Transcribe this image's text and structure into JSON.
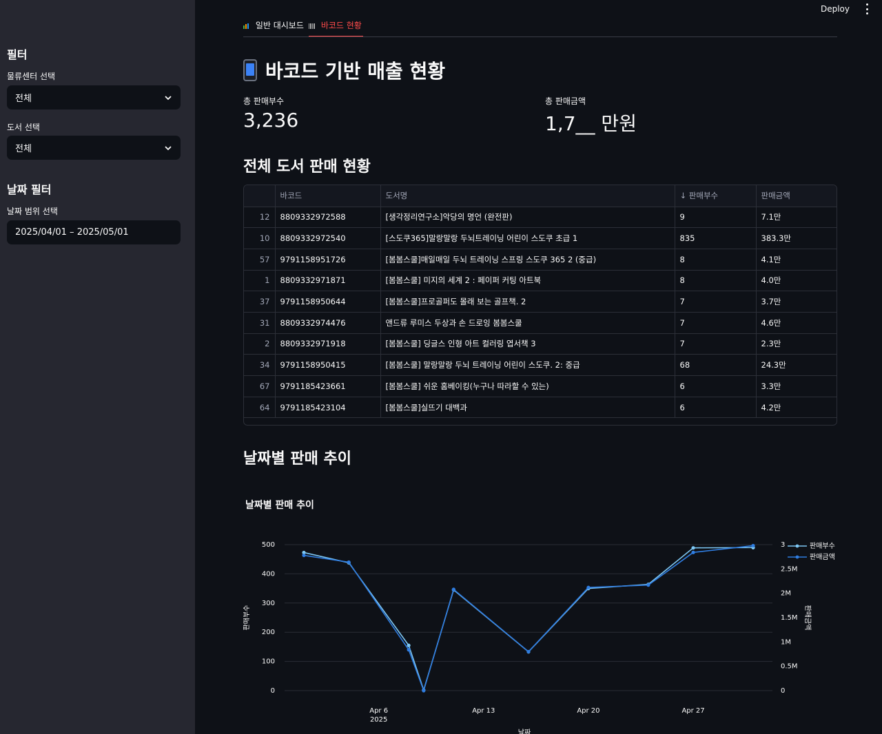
{
  "header": {
    "deploy_label": "Deploy",
    "menu_icon": "kebab-menu-icon"
  },
  "sidebar": {
    "filter_heading": "필터",
    "center_label": "물류센터 선택",
    "center_value": "전체",
    "book_label": "도서 선택",
    "book_value": "전체",
    "date_heading": "날짜 필터",
    "date_label": "날짜 범위 선택",
    "date_value": "2025/04/01 – 2025/05/01"
  },
  "tabs": [
    {
      "label": "일반 대시보드",
      "icon": "chart-icon"
    },
    {
      "label": "바코드 현황",
      "icon": "barcode-icon"
    }
  ],
  "page_title": "바코드 기반 매출 현황",
  "metrics": {
    "qty_label": "총 판매부수",
    "qty_value": "3,236",
    "amount_label": "총 판매금액",
    "amount_value": "1,7__ 만원"
  },
  "table_section_title": "전체 도서 판매 현황",
  "table": {
    "columns": [
      "",
      "바코드",
      "도서명",
      "↓ 판매부수",
      "판매금액"
    ],
    "rows": [
      [
        "12",
        "8809332972588",
        "[생각정리연구소]악당의 명언 (완전판)",
        "9",
        "7.1만"
      ],
      [
        "10",
        "8809332972540",
        "[스도쿠365]말랑말랑 두뇌트레이닝 어린이 스도쿠 초급 1",
        "835",
        "383.3만"
      ],
      [
        "57",
        "9791158951726",
        "[봄봄스쿨]매일매일 두뇌 트레이닝 스프링 스도쿠 365 2 (중급)",
        "8",
        "4.1만"
      ],
      [
        "1",
        "8809332971871",
        "[봄봄스쿨] 미지의 세계 2 : 페이퍼 커팅 아트북",
        "8",
        "4.0만"
      ],
      [
        "37",
        "9791158950644",
        "[봄봄스쿨]프로골퍼도 몰래 보는 골프책. 2",
        "7",
        "3.7만"
      ],
      [
        "31",
        "8809332974476",
        "앤드류 루미스 두상과 손 드로잉 봄봄스쿨",
        "7",
        "4.6만"
      ],
      [
        "2",
        "8809332971918",
        "[봄봄스쿨] 딩글스 인형 아트 컬러링 엽서책 3",
        "7",
        "2.3만"
      ],
      [
        "34",
        "9791158950415",
        "[봄봄스쿨] 말랑말랑 두뇌 트레이닝 어린이 스도쿠. 2: 중급",
        "68",
        "24.3만"
      ],
      [
        "67",
        "9791185423661",
        "[봄봄스쿨] 쉬운 홈베이킹(누구나 따라할 수 있는)",
        "6",
        "3.3만"
      ],
      [
        "64",
        "9791185423104",
        "[봄봄스쿨]실뜨기 대백과",
        "6",
        "4.2만"
      ]
    ]
  },
  "trend_section_title": "날짜별 판매 추이",
  "chart_data": {
    "type": "line",
    "title": "날짜별 판매 추이",
    "xlabel": "날짜",
    "ylabel": "판매부수",
    "y2label": "판매금액",
    "x": [
      "2025-04-01",
      "2025-04-04",
      "2025-04-08",
      "2025-04-09",
      "2025-04-11",
      "2025-04-16",
      "2025-04-20",
      "2025-04-24",
      "2025-04-27",
      "2025-05-01"
    ],
    "series": [
      {
        "name": "판매부수",
        "axis": "y",
        "color": "#7ec8f5",
        "values": [
          473,
          438,
          155,
          2,
          345,
          133,
          350,
          364,
          489,
          490
        ]
      },
      {
        "name": "판매금액",
        "axis": "y2",
        "color": "#2f7de1",
        "values": [
          2.78,
          2.64,
          0.84,
          0.0,
          2.08,
          0.8,
          2.12,
          2.17,
          2.84,
          2.98
        ]
      }
    ],
    "x_ticks": [
      "Apr 6",
      "Apr 13",
      "Apr 20",
      "Apr 27"
    ],
    "x_tick_year": "2025",
    "ylim": [
      0,
      500
    ],
    "y_ticks": [
      "0",
      "100",
      "200",
      "300",
      "400",
      "500"
    ],
    "y2lim": [
      0,
      3
    ],
    "y2_ticks": [
      "0",
      "0.5M",
      "1M",
      "1.5M",
      "2M",
      "2.5M",
      "3"
    ],
    "legend_position": "top-right",
    "grid": true
  }
}
